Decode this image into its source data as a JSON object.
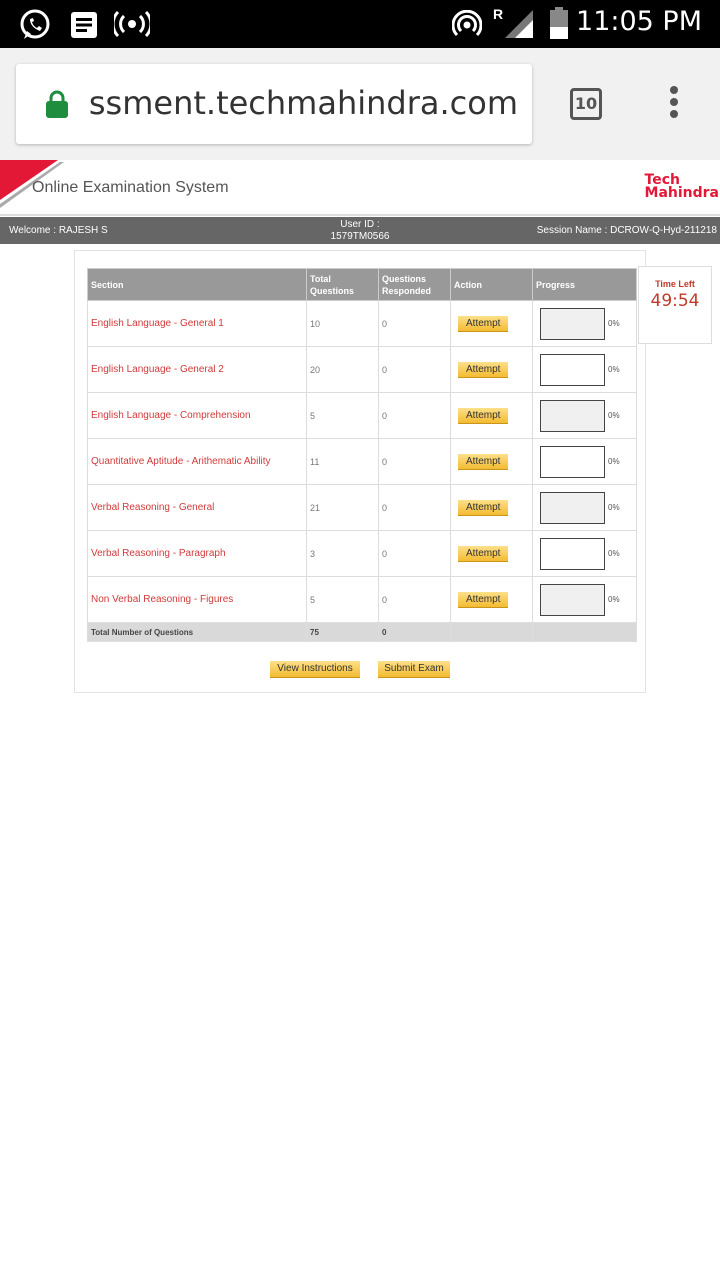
{
  "status_bar": {
    "time": "11:05 PM",
    "roaming": "R",
    "icons": [
      "whatsapp-icon",
      "notes-icon",
      "hotspot-icon",
      "wifi-tethering-icon",
      "signal-icon",
      "battery-icon"
    ]
  },
  "browser": {
    "url": "assessment.techmahindra.com",
    "tab_count": "10"
  },
  "site": {
    "title": "Online Examination System",
    "brand_line1": "Tech",
    "brand_line2": "Mahindra",
    "brand_color": "#e31837"
  },
  "info_bar": {
    "welcome": "Welcome : RAJESH S",
    "user_id_label": "User ID :",
    "user_id": "1579TM0566",
    "session": "Session Name : DCROW-Q-Hyd-211218"
  },
  "table": {
    "headers": {
      "section": "Section",
      "total": "Total Questions",
      "responded": "Questions Responded",
      "action": "Action",
      "progress": "Progress"
    },
    "rows": [
      {
        "section": "English Language - General 1",
        "total": "10",
        "responded": "0",
        "action": "Attempt",
        "progress": "0%"
      },
      {
        "section": "English Language - General 2",
        "total": "20",
        "responded": "0",
        "action": "Attempt",
        "progress": "0%"
      },
      {
        "section": "English Language - Comprehension",
        "total": "5",
        "responded": "0",
        "action": "Attempt",
        "progress": "0%"
      },
      {
        "section": "Quantitative Aptitude - Arithematic Ability",
        "total": "11",
        "responded": "0",
        "action": "Attempt",
        "progress": "0%"
      },
      {
        "section": "Verbal Reasoning - General",
        "total": "21",
        "responded": "0",
        "action": "Attempt",
        "progress": "0%"
      },
      {
        "section": "Verbal Reasoning - Paragraph",
        "total": "3",
        "responded": "0",
        "action": "Attempt",
        "progress": "0%"
      },
      {
        "section": "Non Verbal Reasoning - Figures",
        "total": "5",
        "responded": "0",
        "action": "Attempt",
        "progress": "0%"
      }
    ],
    "total_row": {
      "label": "Total Number of Questions",
      "total": "75",
      "responded": "0"
    }
  },
  "timer": {
    "label": "Time Left",
    "value": "49:54"
  },
  "buttons": {
    "view_instructions": "View Instructions",
    "submit_exam": "Submit Exam"
  }
}
